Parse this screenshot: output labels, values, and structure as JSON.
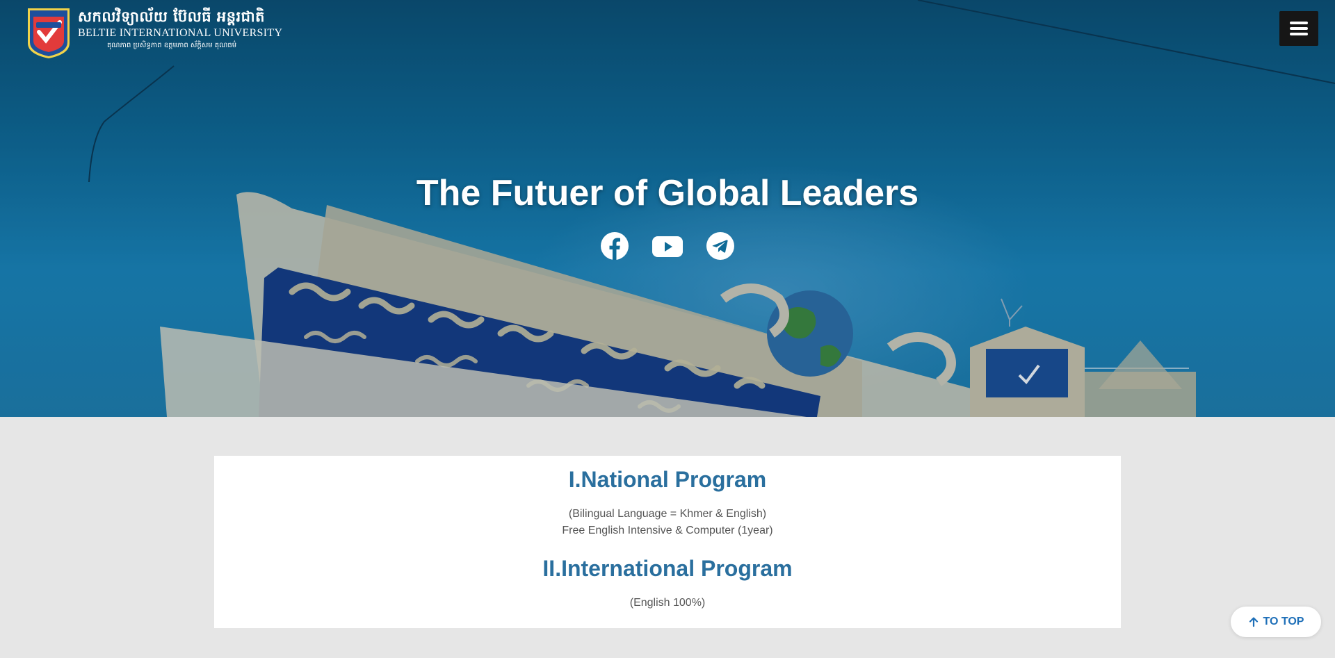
{
  "header": {
    "logo_name_kh": "សកលវិទ្យាល័យ ប៊ែលធី អន្តរជាតិ",
    "logo_name_en": "BELTIE INTERNATIONAL UNIVERSITY",
    "logo_motto_kh": "គុណភាព ប្រសិទ្ធភាព ឧត្តមភាព ស័ក្តិសម គុណធម៌",
    "menu_icon": "hamburger-menu-icon"
  },
  "hero": {
    "title": "The Futuer of Global Leaders",
    "socials": [
      {
        "name": "facebook-icon"
      },
      {
        "name": "youtube-icon"
      },
      {
        "name": "telegram-icon"
      }
    ]
  },
  "programs": {
    "national_title": "I.National Program",
    "national_lines": [
      "(Bilingual Language = Khmer & English)",
      "Free English Intensive & Computer (1year)"
    ],
    "international_title": "II.International Program",
    "international_lines": [
      "(English 100%)"
    ]
  },
  "to_top": {
    "label": "TO TOP",
    "icon": "arrow-up-icon"
  },
  "colors": {
    "accent": "#2a6f9e",
    "to_top_text": "#1e6fb8",
    "hero_blue": "#0f6b97",
    "page_bg": "#e6e6e6"
  }
}
